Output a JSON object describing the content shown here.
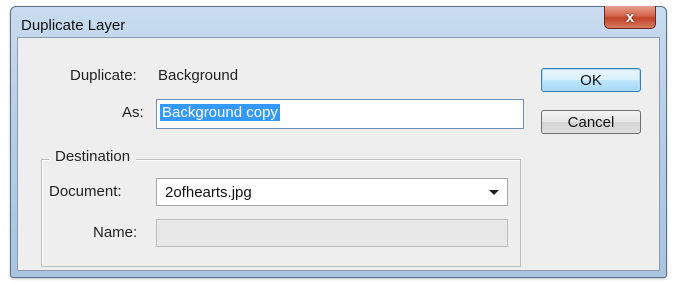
{
  "window": {
    "title": "Duplicate Layer",
    "close_symbol": "x"
  },
  "form": {
    "duplicate_label": "Duplicate:",
    "duplicate_value": "Background",
    "as_label": "As:",
    "as_value": "Background copy",
    "as_selected": true
  },
  "destination": {
    "legend": "Destination",
    "document_label": "Document:",
    "document_value": "2ofhearts.jpg",
    "name_label": "Name:",
    "name_value": "",
    "name_enabled": false
  },
  "buttons": {
    "ok_label": "OK",
    "cancel_label": "Cancel"
  },
  "icons": {
    "close": "close-icon",
    "dropdown": "chevron-down-icon"
  }
}
